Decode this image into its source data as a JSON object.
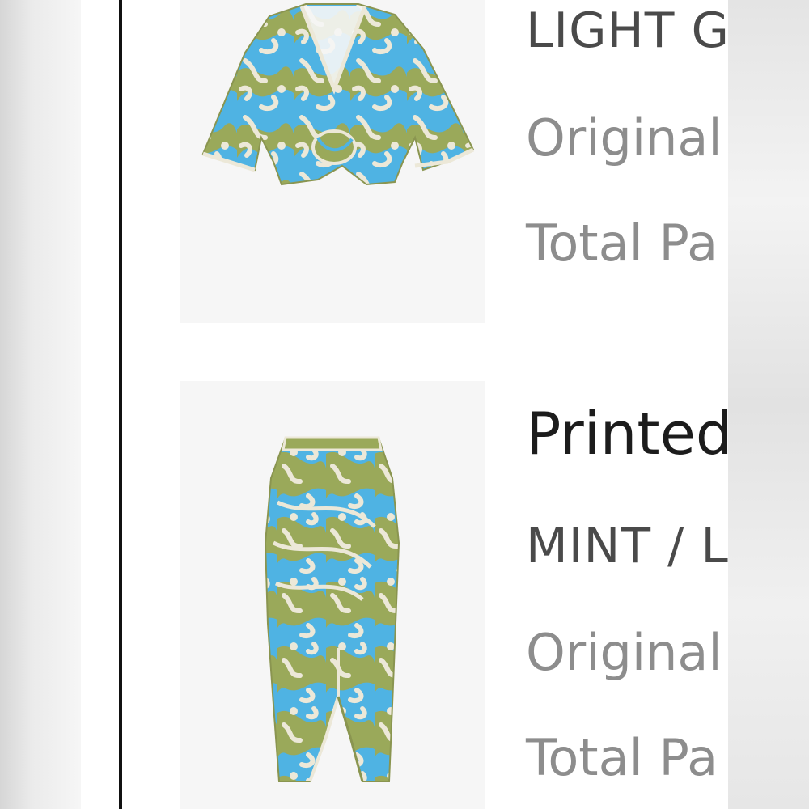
{
  "items": [
    {
      "color": "LIGHT G",
      "original_label": "Original",
      "total_label": "Total Pa",
      "image_icon": "cropped-wrap-top-image"
    },
    {
      "name": "Printed",
      "color": "MINT / L",
      "original_label": "Original",
      "total_label": "Total Pa",
      "image_icon": "midi-wrap-skirt-image"
    }
  ],
  "colors": {
    "print_blue": "#4fb3e3",
    "print_olive": "#9aa95a",
    "print_cream": "#ece8d8",
    "thumb_bg": "#f6f6f6",
    "divider": "#111111"
  }
}
